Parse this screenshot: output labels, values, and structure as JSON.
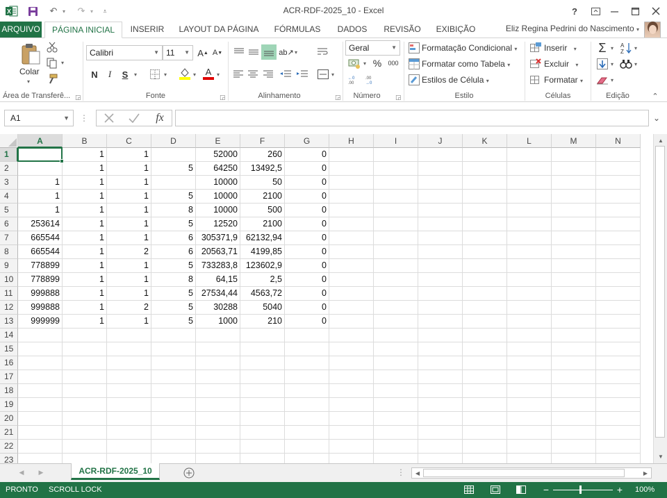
{
  "window": {
    "title": "ACR-RDF-2025_10 - Excel"
  },
  "tabs": [
    "ARQUIVO",
    "PÁGINA INICIAL",
    "INSERIR",
    "LAYOUT DA PÁGINA",
    "FÓRMULAS",
    "DADOS",
    "REVISÃO",
    "EXIBIÇÃO"
  ],
  "active_tab": "PÁGINA INICIAL",
  "user": {
    "name": "Eliz Regina Pedrini do Nascimento"
  },
  "ribbon": {
    "clipboard": {
      "paste": "Colar",
      "label": "Área de Transferê..."
    },
    "font": {
      "name": "Calibri",
      "size": "11",
      "label": "Fonte",
      "bold": "N",
      "italic": "I",
      "underline": "S"
    },
    "alignment": {
      "label": "Alinhamento"
    },
    "number": {
      "format": "Geral",
      "label": "Número",
      "percent": "%",
      "thousands": "000"
    },
    "styles": {
      "conditional": "Formatação Condicional",
      "as_table": "Formatar como Tabela",
      "cell_styles": "Estilos de Célula",
      "label": "Estilo"
    },
    "cells": {
      "insert": "Inserir",
      "delete": "Excluir",
      "format": "Formatar",
      "label": "Células"
    },
    "editing": {
      "label": "Edição"
    }
  },
  "namebox": {
    "value": "A1"
  },
  "columns": [
    "A",
    "B",
    "C",
    "D",
    "E",
    "F",
    "G",
    "H",
    "I",
    "J",
    "K",
    "L",
    "M",
    "N"
  ],
  "selected_cell": "A1",
  "rows": [
    [
      "",
      "1",
      "1",
      "",
      "52000",
      "260",
      "0"
    ],
    [
      "",
      "1",
      "1",
      "5",
      "64250",
      "13492,5",
      "0"
    ],
    [
      "1",
      "1",
      "1",
      "",
      "10000",
      "50",
      "0"
    ],
    [
      "1",
      "1",
      "1",
      "5",
      "10000",
      "2100",
      "0"
    ],
    [
      "1",
      "1",
      "1",
      "8",
      "10000",
      "500",
      "0"
    ],
    [
      "253614",
      "1",
      "1",
      "5",
      "12520",
      "2100",
      "0"
    ],
    [
      "665544",
      "1",
      "1",
      "6",
      "305371,9",
      "62132,94",
      "0"
    ],
    [
      "665544",
      "1",
      "2",
      "6",
      "20563,71",
      "4199,85",
      "0"
    ],
    [
      "778899",
      "1",
      "1",
      "5",
      "733283,8",
      "123602,9",
      "0"
    ],
    [
      "778899",
      "1",
      "1",
      "8",
      "64,15",
      "2,5",
      "0"
    ],
    [
      "999888",
      "1",
      "1",
      "5",
      "27534,44",
      "4563,72",
      "0"
    ],
    [
      "999888",
      "1",
      "2",
      "5",
      "30288",
      "5040",
      "0"
    ],
    [
      "999999",
      "1",
      "1",
      "5",
      "1000",
      "210",
      "0"
    ]
  ],
  "row_numbers": [
    "1",
    "2",
    "3",
    "4",
    "5",
    "6",
    "7",
    "8",
    "9",
    "10",
    "11",
    "12",
    "13",
    "14",
    "15",
    "16",
    "17",
    "18",
    "19",
    "20",
    "21",
    "22",
    "23"
  ],
  "sheets": [
    {
      "name": "ACR-RDF-2025_10"
    }
  ],
  "status": {
    "ready": "PRONTO",
    "scroll_lock": "SCROLL LOCK",
    "zoom": "100%"
  },
  "colors": {
    "accent": "#217346"
  }
}
